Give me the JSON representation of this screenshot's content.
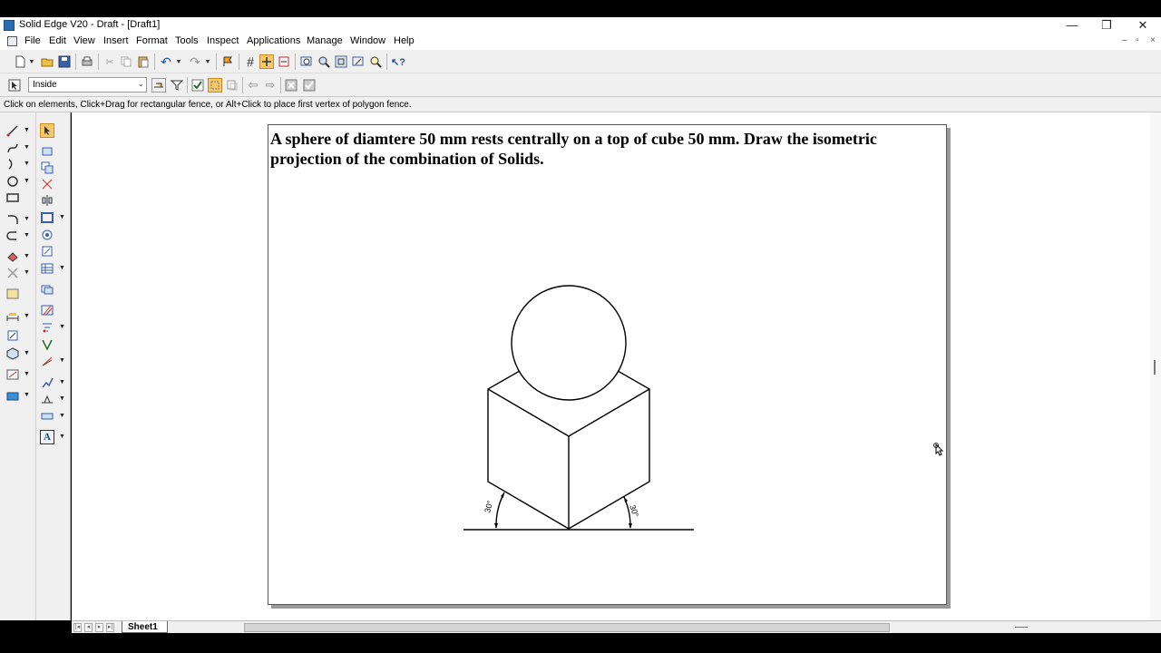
{
  "window": {
    "title": "Solid Edge V20 - Draft - [Draft1]",
    "controls": {
      "minimize": "—",
      "restore": "❐",
      "close": "✕"
    }
  },
  "menu": {
    "items": [
      "File",
      "Edit",
      "View",
      "Insert",
      "Format",
      "Tools",
      "Inspect",
      "Applications",
      "Manage",
      "Window",
      "Help"
    ],
    "mdi_controls": {
      "minimize": "–",
      "restore": "▫",
      "close": "×"
    }
  },
  "select_toolbar": {
    "selection_mode": "Inside"
  },
  "prompt": {
    "message": "Click on elements, Click+Drag for rectangular fence, or Alt+Click to place first vertex of polygon fence."
  },
  "sheet": {
    "tab_label": "Sheet1"
  },
  "drawing": {
    "problem_text": "A sphere of diamtere 50 mm rests centrally on a top of cube 50 mm. Draw the isometric projection of the combination of Solids.",
    "angle_left": "30°",
    "angle_right": "30°"
  },
  "colors": {
    "chrome": "#f0f0f0",
    "active_tool": "#f7c86b",
    "paper_shadow": "#9a9a9a"
  },
  "icons": {
    "toolbar1": [
      "new-icon",
      "open-icon",
      "save-icon",
      "print-icon",
      "cut-icon",
      "copy-icon",
      "paste-icon",
      "undo-icon",
      "redo-icon",
      "symbol-icon",
      "grid-icon",
      "intellisketch-icon",
      "dimension-icon",
      "zoom-area-icon",
      "zoom-icon",
      "fit-icon",
      "pan-icon",
      "zoom-in-icon",
      "whats-this-icon"
    ],
    "toolbar2": [
      "select-tool-icon",
      "fence-icon",
      "filter-icon",
      "check-icon",
      "inside-fence-icon",
      "overlap-fence-icon",
      "previous-icon",
      "next-icon",
      "reject-icon",
      "accept-icon"
    ]
  }
}
